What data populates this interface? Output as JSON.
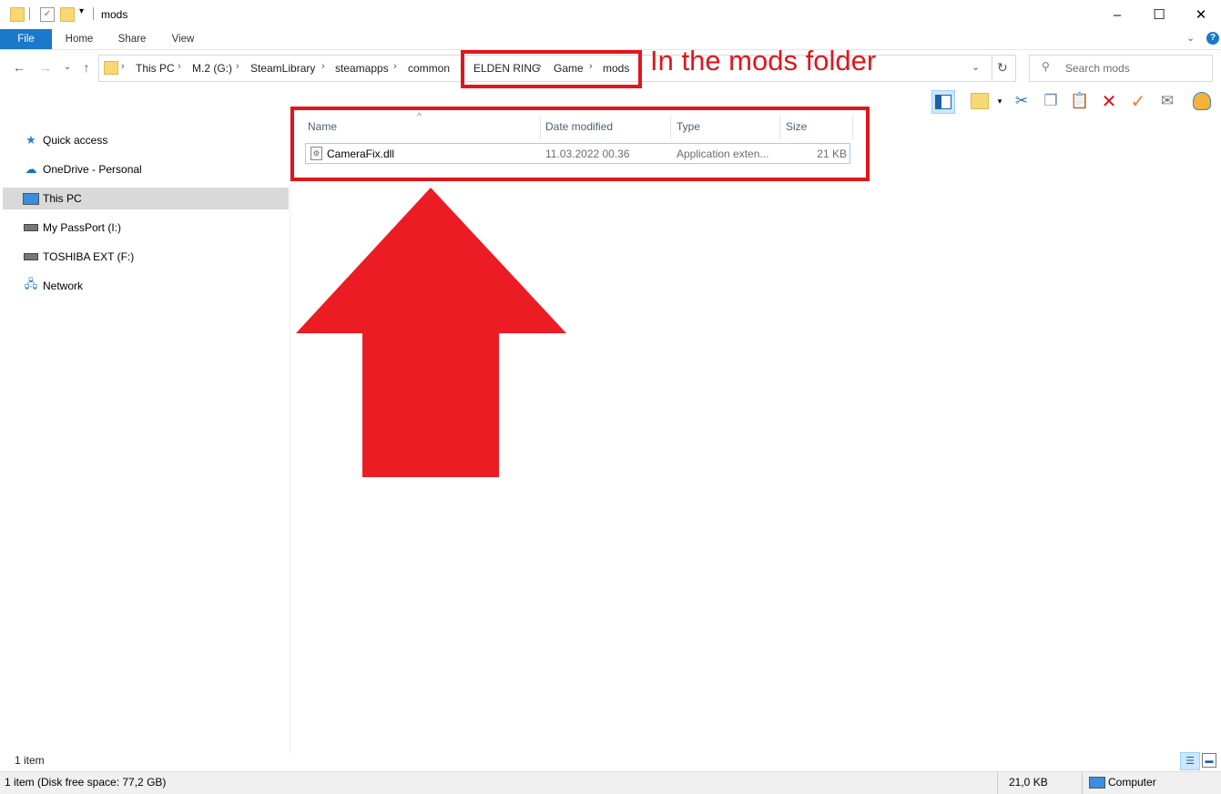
{
  "window": {
    "title": "mods",
    "minimize_glyph": "–",
    "maximize_glyph": "☐",
    "close_glyph": "✕"
  },
  "ribbon": {
    "tabs": [
      "File",
      "Home",
      "Share",
      "View"
    ],
    "file_color": "#1979ca"
  },
  "address": {
    "crumbs": [
      "This PC",
      "M.2 (G:)",
      "SteamLibrary",
      "steamapps",
      "common",
      "ELDEN RING",
      "Game",
      "mods"
    ],
    "search_placeholder": "Search mods"
  },
  "toolbar_icons": [
    "preview-pane-icon",
    "properties-icon",
    "cut-icon",
    "copy-icon",
    "paste-icon",
    "delete-icon",
    "rename-check-icon",
    "email-icon",
    "shell-icon"
  ],
  "nav": {
    "items": [
      {
        "label": "Quick access",
        "icon": "star-icon"
      },
      {
        "label": "OneDrive - Personal",
        "icon": "cloud-icon"
      },
      {
        "label": "This PC",
        "icon": "computer-icon",
        "selected": true
      },
      {
        "label": "My PassPort (I:)",
        "icon": "drive-icon"
      },
      {
        "label": "TOSHIBA EXT (F:)",
        "icon": "drive-icon"
      },
      {
        "label": "Network",
        "icon": "network-icon"
      }
    ]
  },
  "details": {
    "columns": [
      "Name",
      "Date modified",
      "Type",
      "Size"
    ],
    "files": [
      {
        "name": "CameraFix.dll",
        "modified": "11.03.2022 00.36",
        "type": "Application exten...",
        "size": "21 KB"
      }
    ]
  },
  "annotation": {
    "text": "In the mods folder",
    "color": "#e0161d"
  },
  "status": {
    "item_count": "1 item",
    "bottom_left": "1 item (Disk free space: 77,2 GB)",
    "size": "21,0 KB",
    "location": "Computer"
  }
}
